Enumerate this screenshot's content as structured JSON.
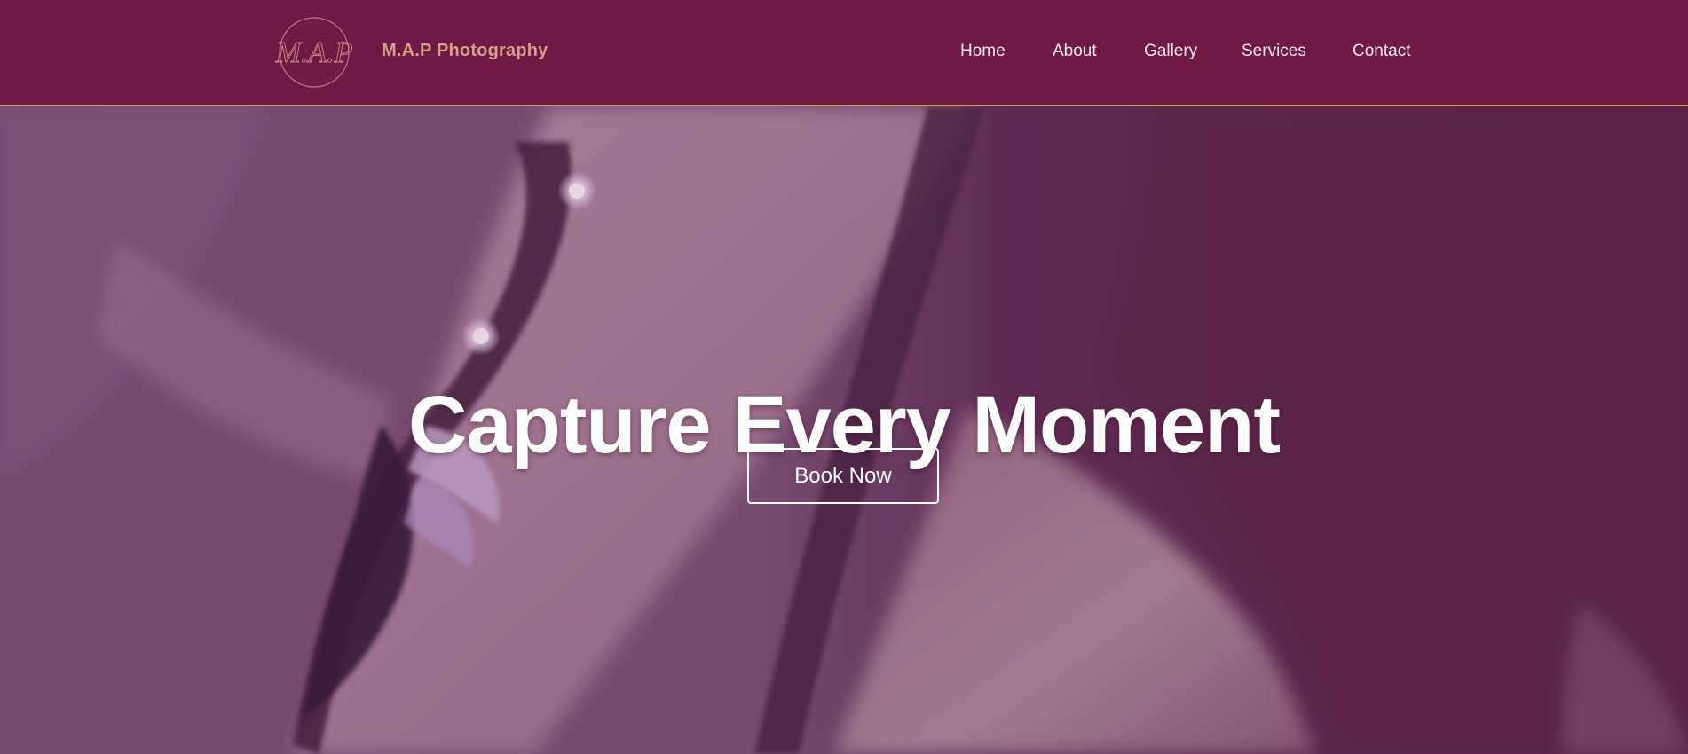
{
  "brand": {
    "logo_initials": "M.A.P",
    "name": "M.A.P Photography"
  },
  "nav": {
    "items": [
      {
        "label": "Home"
      },
      {
        "label": "About"
      },
      {
        "label": "Gallery"
      },
      {
        "label": "Services"
      },
      {
        "label": "Contact"
      }
    ]
  },
  "hero": {
    "title": "Capture Every Moment",
    "cta_label": "Book Now"
  },
  "colors": {
    "header_bg": "#701944",
    "accent_gold": "#d4a088",
    "hero_overlay": "#6d2a5a",
    "text_light": "#ffffff"
  }
}
